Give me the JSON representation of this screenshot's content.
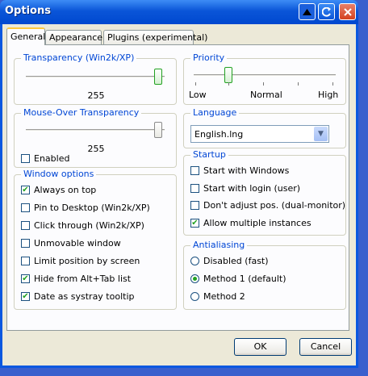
{
  "window": {
    "title": "Options"
  },
  "tabs": [
    {
      "label": "General"
    },
    {
      "label": "Appearance"
    },
    {
      "label": "Plugins (experimental)"
    }
  ],
  "transparency": {
    "label": "Transparency (Win2k/XP)",
    "value": "255",
    "level": 1.0
  },
  "mouseover": {
    "label": "Mouse-Over Transparency",
    "value": "255",
    "level": 1.0,
    "enabled_label": "Enabled",
    "enabled_checked": false
  },
  "window_options": {
    "label": "Window options",
    "items": [
      {
        "label": "Always on top",
        "checked": true
      },
      {
        "label": "Pin to Desktop (Win2k/XP)",
        "checked": false
      },
      {
        "label": "Click through (Win2k/XP)",
        "checked": false
      },
      {
        "label": "Unmovable window",
        "checked": false
      },
      {
        "label": "Limit position by screen",
        "checked": false
      },
      {
        "label": "Hide from Alt+Tab list",
        "checked": true
      },
      {
        "label": "Date as systray tooltip",
        "checked": true
      }
    ]
  },
  "priority": {
    "label": "Priority",
    "low": "Low",
    "normal": "Normal",
    "high": "High",
    "level": 0.25
  },
  "language": {
    "label": "Language",
    "selected": "English.lng"
  },
  "startup": {
    "label": "Startup",
    "items": [
      {
        "label": "Start with Windows",
        "checked": false
      },
      {
        "label": "Start with login (user)",
        "checked": false
      },
      {
        "label": "Don't adjust pos. (dual-monitor)",
        "checked": false
      },
      {
        "label": "Allow multiple instances",
        "checked": true
      }
    ]
  },
  "antialiasing": {
    "label": "Antialiasing",
    "options": [
      {
        "label": "Disabled (fast)",
        "selected": false
      },
      {
        "label": "Method 1 (default)",
        "selected": true
      },
      {
        "label": "Method 2",
        "selected": false
      }
    ]
  },
  "buttons": {
    "ok": "OK",
    "cancel": "Cancel"
  }
}
